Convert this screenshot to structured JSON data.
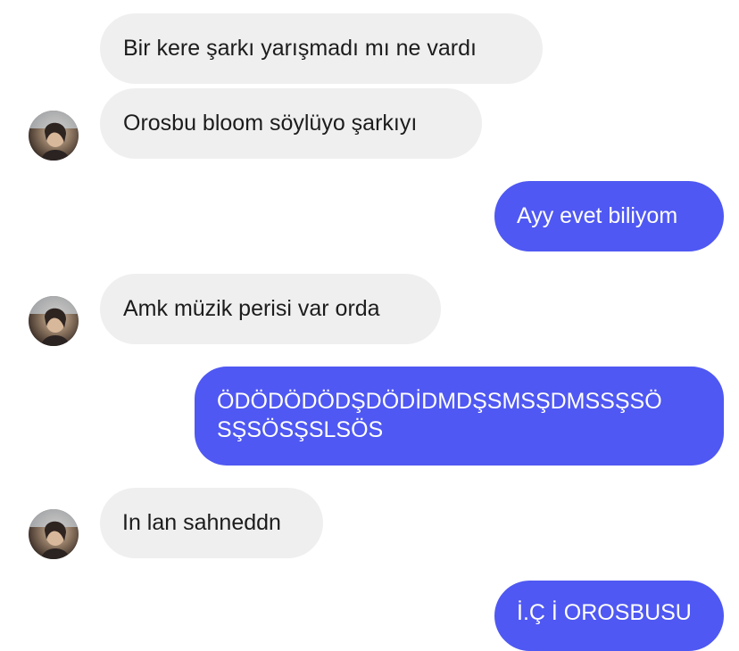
{
  "messages": [
    {
      "id": "m1",
      "side": "incoming",
      "text": "Bir kere şarkı yarışmadı mı ne vardı"
    },
    {
      "id": "m2",
      "side": "incoming",
      "text": "Orosbu bloom söylüyo şarkıyı"
    },
    {
      "id": "m3",
      "side": "outgoing",
      "text": "Ayy evet biliyom"
    },
    {
      "id": "m4",
      "side": "incoming",
      "text": "Amk müzik perisi var orda"
    },
    {
      "id": "m5",
      "side": "outgoing",
      "line1": "ÖDÖDÖDÖDŞDÖDİDMDŞSMSŞDMSSŞSÖ",
      "line2": "SŞSÖSŞSLSÖS"
    },
    {
      "id": "m6",
      "side": "incoming",
      "text": "In lan sahneddn"
    },
    {
      "id": "m7",
      "side": "outgoing",
      "text": "İ.Ç İ OROSBUSU"
    }
  ],
  "colors": {
    "incoming_bubble": "#efefef",
    "incoming_text": "#1c1c1c",
    "outgoing_bubble": "#4f58f2",
    "outgoing_text": "#ffffff"
  },
  "icons": {
    "avatar": "contact-avatar-photo"
  }
}
